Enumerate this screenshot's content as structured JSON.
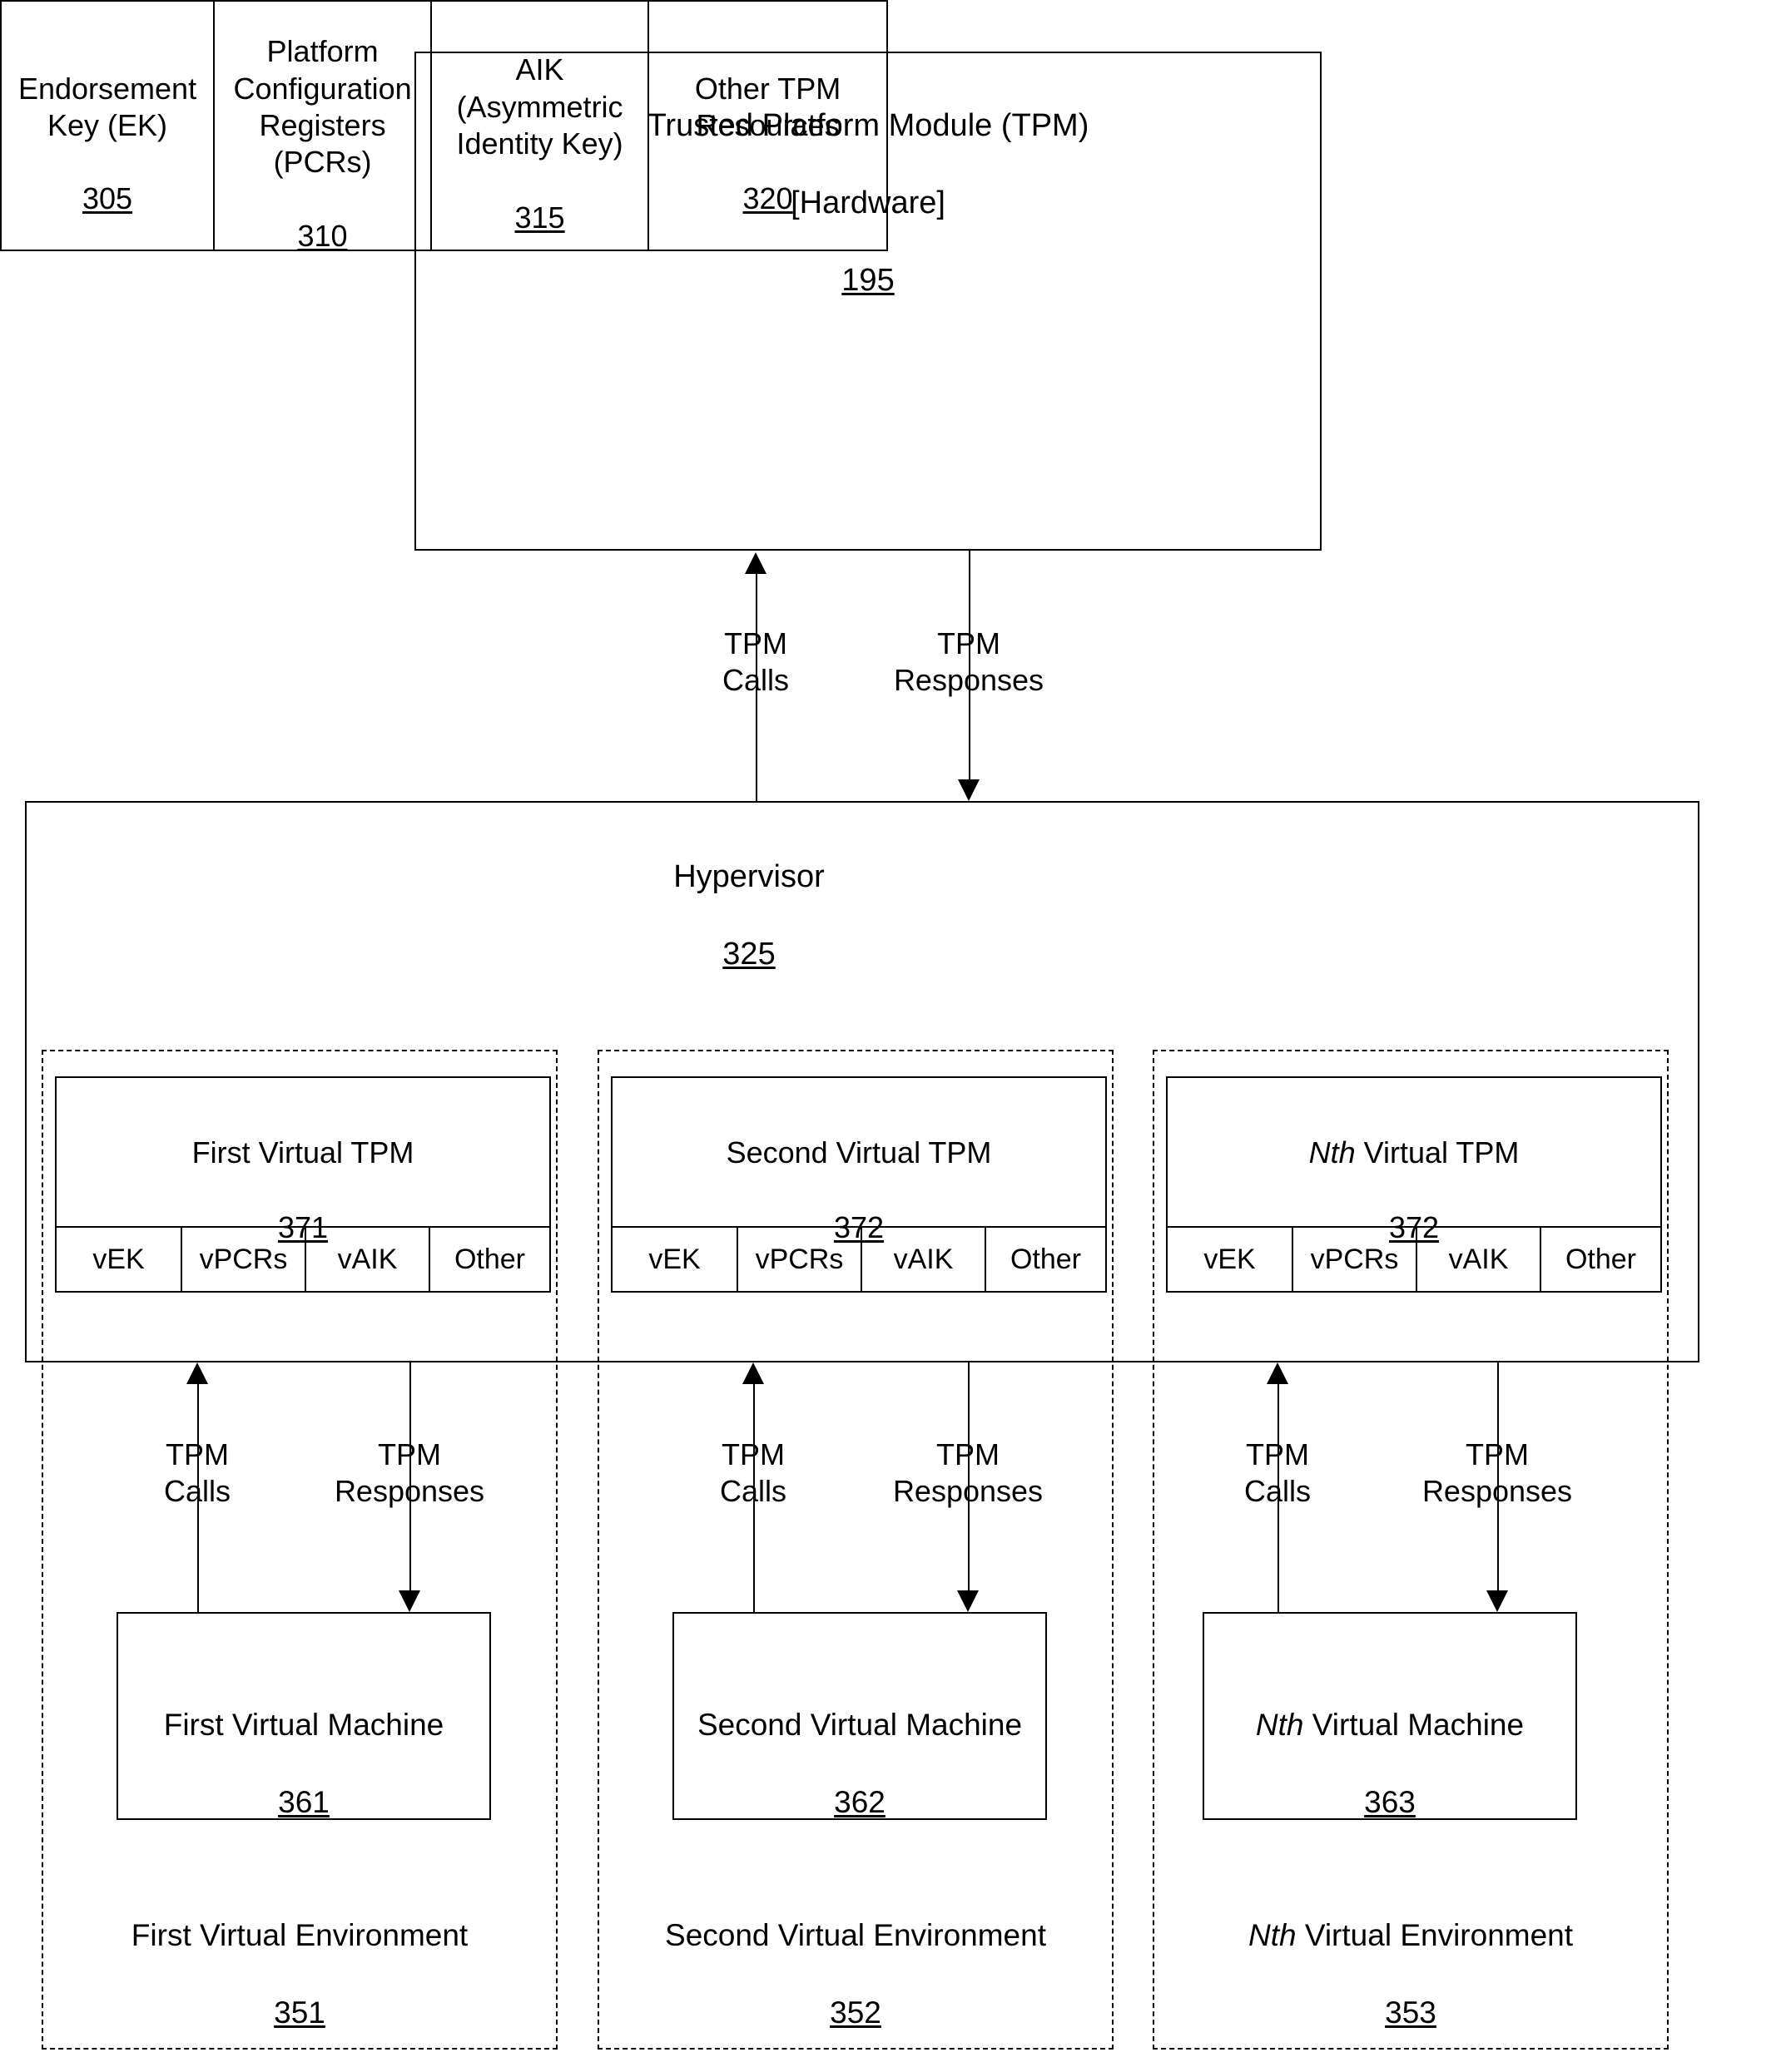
{
  "tpm": {
    "title_line1": "Trusted Platform Module (TPM)",
    "title_line2": "[Hardware]",
    "ref": "195",
    "resources": [
      {
        "name": "Endorsement\nKey (EK)",
        "ref": "305"
      },
      {
        "name": "Platform\nConfiguration\nRegisters\n(PCRs)",
        "ref": "310"
      },
      {
        "name": "AIK\n(Asymmetric\nIdentity Key)",
        "ref": "315"
      },
      {
        "name": "Other TPM\nResources",
        "ref": "320"
      }
    ]
  },
  "hypervisor": {
    "title": "Hypervisor",
    "ref": "325"
  },
  "flows_top": [
    {
      "label": "TPM\nCalls",
      "direction": "up"
    },
    {
      "label": "TPM\nResponses",
      "direction": "down"
    }
  ],
  "flows_bottom": [
    {
      "label": "TPM\nCalls",
      "direction": "up"
    },
    {
      "label": "TPM\nResponses",
      "direction": "down"
    },
    {
      "label": "TPM\nCalls",
      "direction": "up"
    },
    {
      "label": "TPM\nResponses",
      "direction": "down"
    },
    {
      "label": "TPM\nCalls",
      "direction": "up"
    },
    {
      "label": "TPM\nResponses",
      "direction": "down"
    }
  ],
  "virtual_tpms": [
    {
      "prefix": "",
      "prefix_italic": "",
      "name": "First Virtual TPM",
      "ref": "371",
      "cells": [
        "vEK",
        "vPCRs",
        "vAIK",
        "Other"
      ]
    },
    {
      "prefix": "",
      "prefix_italic": "",
      "name": "Second Virtual TPM",
      "ref": "372",
      "cells": [
        "vEK",
        "vPCRs",
        "vAIK",
        "Other"
      ]
    },
    {
      "prefix": "",
      "prefix_italic": "Nth",
      "name": " Virtual TPM",
      "ref": "372",
      "cells": [
        "vEK",
        "vPCRs",
        "vAIK",
        "Other"
      ]
    }
  ],
  "virtual_machines": [
    {
      "prefix_italic": "",
      "name": "First Virtual Machine",
      "ref": "361"
    },
    {
      "prefix_italic": "",
      "name": "Second Virtual Machine",
      "ref": "362"
    },
    {
      "prefix_italic": "Nth",
      "name": " Virtual Machine",
      "ref": "363"
    }
  ],
  "virtual_environments": [
    {
      "prefix_italic": "",
      "name": "First Virtual Environment",
      "ref": "351"
    },
    {
      "prefix_italic": "",
      "name": "Second Virtual Environment",
      "ref": "352"
    },
    {
      "prefix_italic": "Nth",
      "name": " Virtual Environment",
      "ref": "353"
    }
  ],
  "colors": {
    "stroke": "#000000",
    "background": "#ffffff"
  }
}
